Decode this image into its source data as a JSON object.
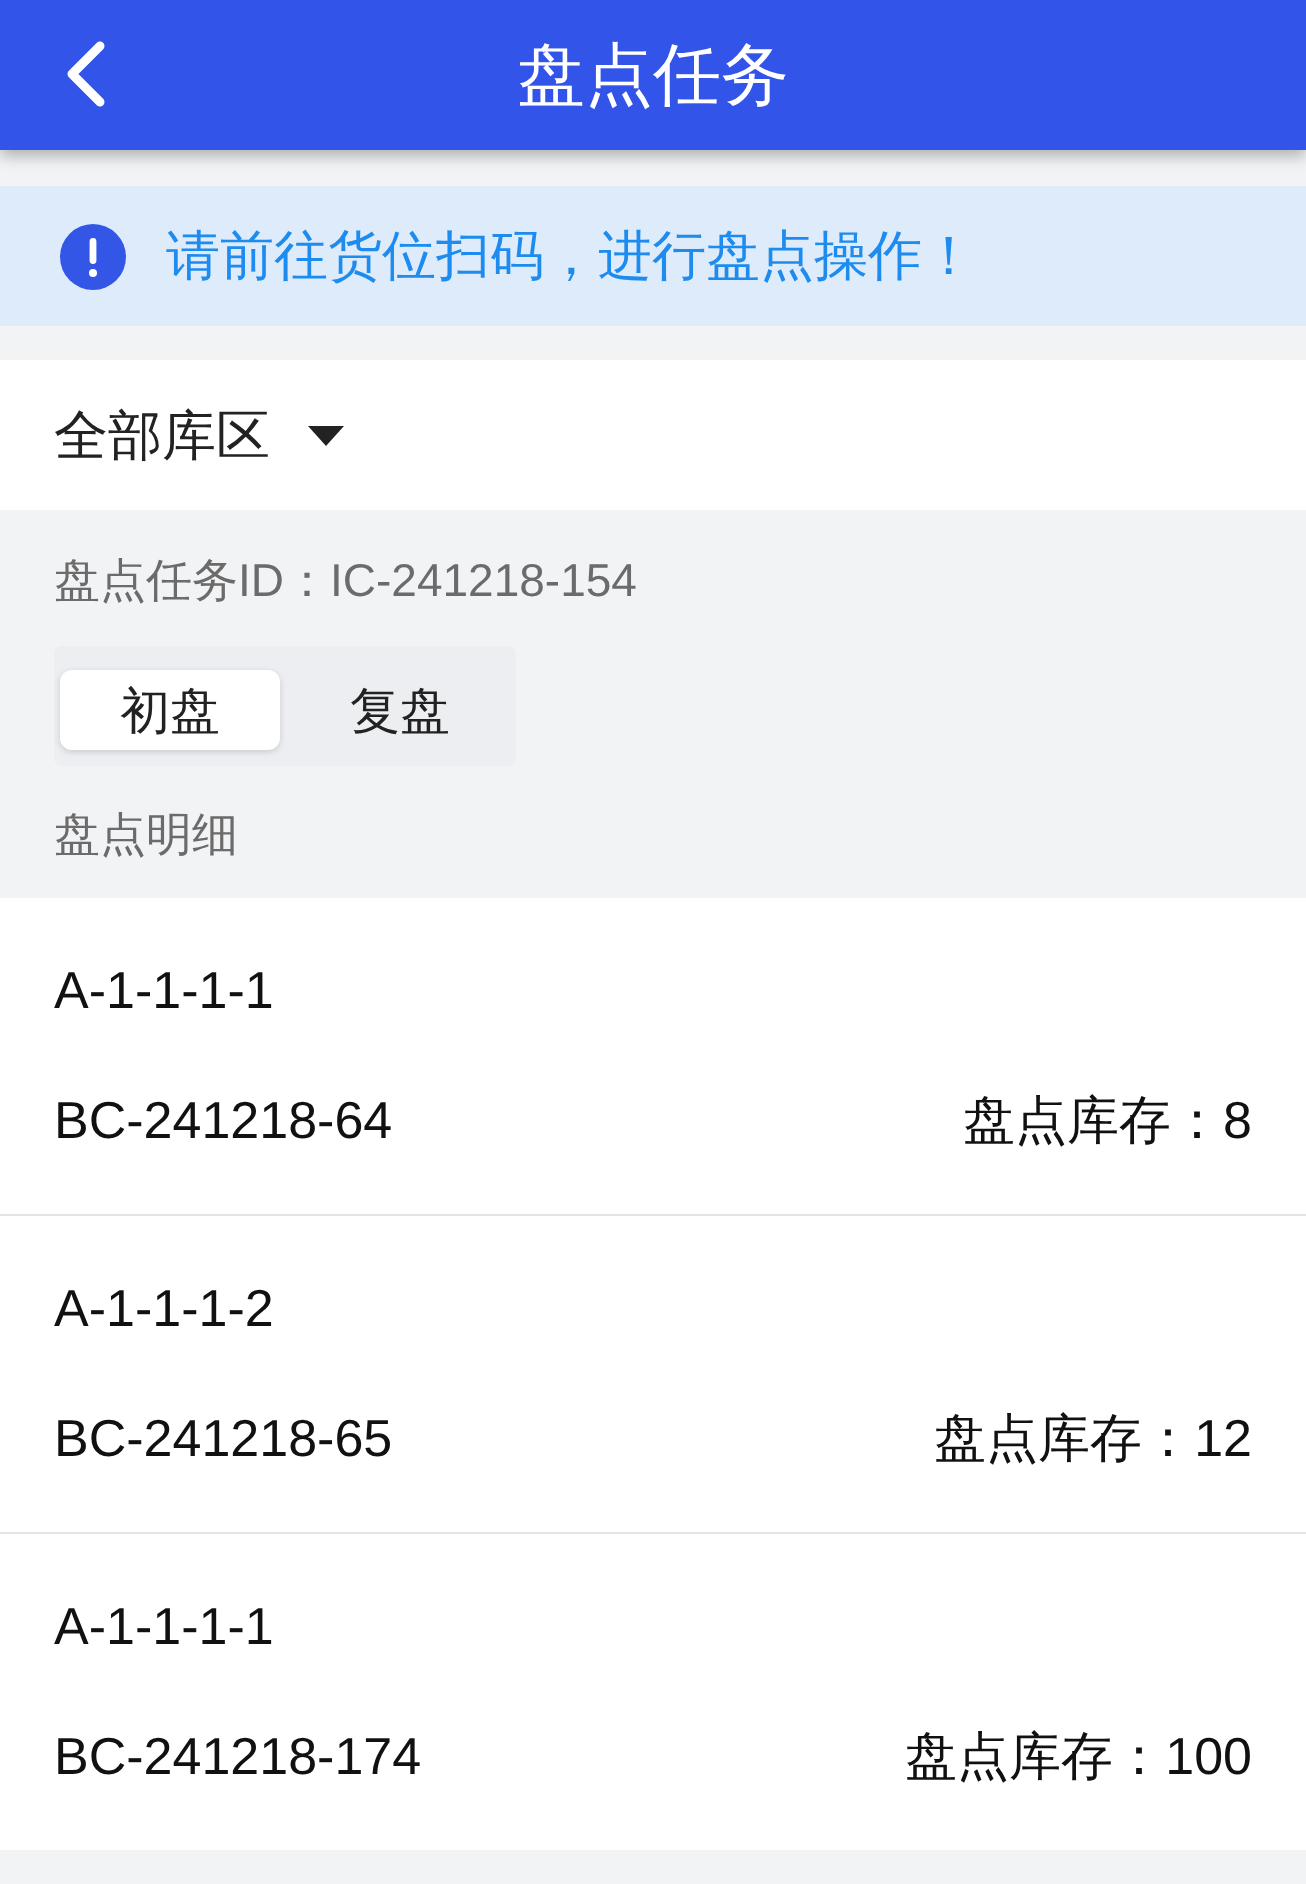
{
  "header": {
    "title": "盘点任务"
  },
  "notice": {
    "text": "请前往货位扫码，进行盘点操作！"
  },
  "filter": {
    "label": "全部库区"
  },
  "task": {
    "id_text": "盘点任务ID：IC-241218-154"
  },
  "tabs": [
    {
      "label": "初盘",
      "selected": true
    },
    {
      "label": "复盘",
      "selected": false
    }
  ],
  "section_title": "盘点明细",
  "items": [
    {
      "location": "A-1-1-1-1",
      "batch": "BC-241218-64",
      "stock": "盘点库存：8"
    },
    {
      "location": "A-1-1-1-2",
      "batch": "BC-241218-65",
      "stock": "盘点库存：12"
    },
    {
      "location": "A-1-1-1-1",
      "batch": "BC-241218-174",
      "stock": "盘点库存：100"
    }
  ]
}
